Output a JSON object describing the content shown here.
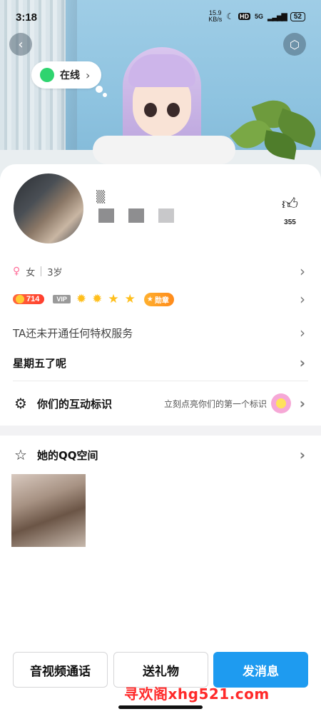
{
  "status_bar": {
    "time": "3:18",
    "net_speed": "15.9",
    "net_unit": "KB/s",
    "hd": "HD",
    "signal": "5G",
    "battery": "52"
  },
  "header": {
    "status_label": "在线"
  },
  "profile": {
    "likes": "355",
    "gender": "女",
    "age": "3岁",
    "level": "714",
    "vip": "VIP",
    "medal": "勋章",
    "privilege_text": "TA还未开通任何特权服务",
    "signature": "星期五了呢",
    "interaction_title": "你们的互动标识",
    "interaction_hint": "立刻点亮你们的第一个标识",
    "qzone_title": "她的QQ空间"
  },
  "actions": {
    "call": "音视频通话",
    "gift": "送礼物",
    "message": "发消息"
  },
  "watermark": "寻欢阁xhg521.com",
  "colors": {
    "primary": "#1e9bf0",
    "online": "#2fd46f",
    "level_badge": "#ff4a30",
    "watermark": "#ff2a2a"
  }
}
